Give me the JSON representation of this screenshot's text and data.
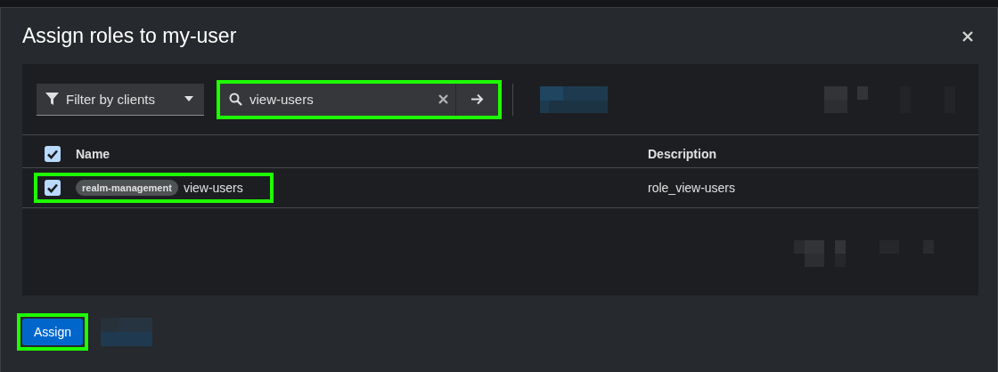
{
  "dialog": {
    "title": "Assign roles to my-user"
  },
  "toolbar": {
    "filter": {
      "label": "Filter by clients"
    },
    "search": {
      "value": "view-users",
      "highlighted": true
    }
  },
  "table": {
    "select_all": {
      "checked": true
    },
    "columns": [
      "Name",
      "Description"
    ],
    "rows": [
      {
        "checked": true,
        "highlighted": true,
        "client": "realm-management",
        "name": "view-users",
        "description": "role_view-users"
      }
    ]
  },
  "actions": [
    {
      "label": "Assign",
      "kind": "primary",
      "highlighted": true
    }
  ]
}
